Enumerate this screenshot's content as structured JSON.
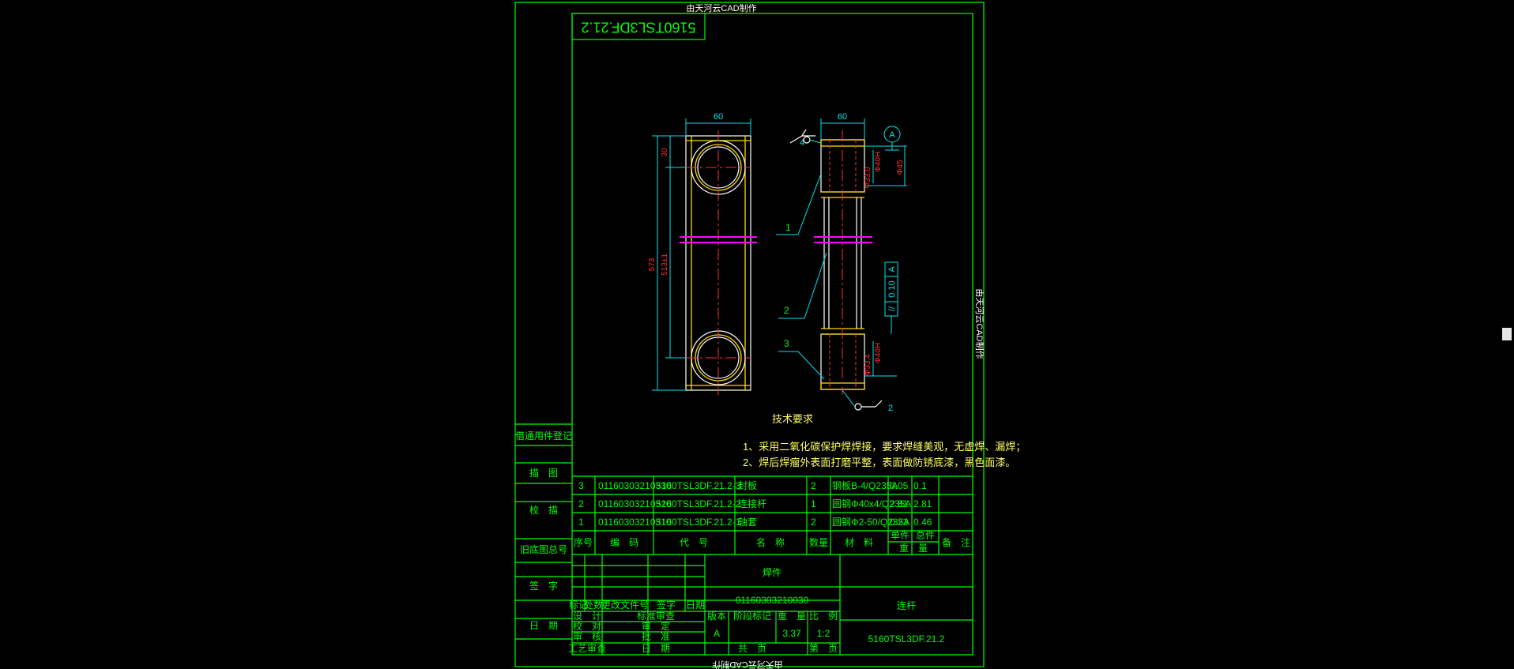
{
  "watermark": "由天河云CAD制作",
  "drawing_code_mirrored": "5160TSL3DF.21.2",
  "tech_req": {
    "title": "技术要求",
    "items": [
      "1、采用二氧化碳保护焊焊接，要求焊缝美观，无虚焊、漏焊；",
      "2、焊后焊瘤外表面打磨平整，表面做防锈底漆，黑色面漆。"
    ]
  },
  "left_labels": {
    "reg": "借通用件登记",
    "trace": "描　图",
    "check": "校　描",
    "old_no": "旧底图总号",
    "sign": "签　字",
    "date": "日　期"
  },
  "dims": {
    "w60a": "60",
    "w60b": "60",
    "d30": "30",
    "d573": "573",
    "d513": "513±1",
    "dia40": "Φ40H",
    "dia330": "Φ33.0",
    "dia45": "Φ45",
    "dia40b": "Φ40H",
    "dia334": "Φ33.4",
    "datum": "A",
    "tol": "0.10",
    "weld1": "1",
    "weld2": "2",
    "weld_num": "4"
  },
  "callouts": [
    "1",
    "2",
    "3"
  ],
  "bom": {
    "headers": [
      "序号",
      "编　码",
      "代　号",
      "名　称",
      "数量",
      "材　料",
      "单件",
      "总件",
      "重　量",
      "备　注"
    ],
    "rows": [
      {
        "no": "3",
        "code": "01160303210330",
        "part": "5160TSL3DF.21.2-3",
        "name": "封板",
        "qty": "2",
        "mat": "钢板B-4/Q235A",
        "unit": "0.05",
        "total": "0.1"
      },
      {
        "no": "2",
        "code": "01160303210320",
        "part": "5160TSL3DF.21.2-2",
        "name": "连接杆",
        "qty": "1",
        "mat": "圆钢Φ40x4/Q235A",
        "unit": "2.81",
        "total": "2.81"
      },
      {
        "no": "1",
        "code": "01160303210310",
        "part": "5160TSL3DF.21.2-1",
        "name": "轴套",
        "qty": "2",
        "mat": "圆钢Φ2-50/Q235A",
        "unit": "0.23",
        "total": "0.46"
      }
    ]
  },
  "title_block": {
    "type": "焊件",
    "code": "01160303210030",
    "name": "连杆",
    "drawing_no": "5160TSL3DF.21.2",
    "mark_labels": [
      "标记",
      "处数",
      "更改文件号",
      "签字",
      "日期"
    ],
    "roles": [
      "设　计",
      "校　对",
      "审　核",
      "工艺审查"
    ],
    "roles2": [
      "标准审查",
      "审　定",
      "批　准",
      "日　期"
    ],
    "phase_headers": [
      "版本",
      "阶段标记",
      "重　量",
      "比　例"
    ],
    "version": "A",
    "weight": "3.37",
    "scale": "1:2",
    "sheets_total": "共　页",
    "sheet": "第　页"
  }
}
